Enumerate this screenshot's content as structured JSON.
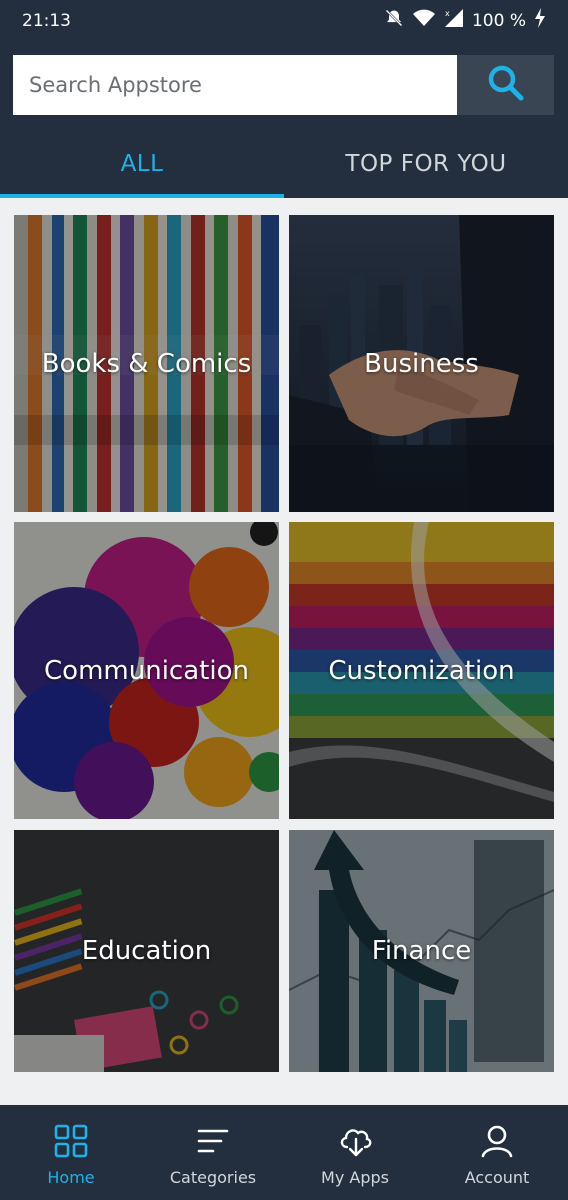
{
  "status_bar": {
    "time": "21:13",
    "battery": "100 %"
  },
  "search": {
    "placeholder": "Search Appstore"
  },
  "tabs": [
    {
      "label": "ALL",
      "active": true
    },
    {
      "label": "TOP FOR YOU",
      "active": false
    }
  ],
  "categories": [
    {
      "label": "Books & Comics"
    },
    {
      "label": "Business"
    },
    {
      "label": "Communication"
    },
    {
      "label": "Customization"
    },
    {
      "label": "Education"
    },
    {
      "label": "Finance"
    }
  ],
  "bottom_nav": [
    {
      "label": "Home",
      "icon": "grid-icon",
      "active": true
    },
    {
      "label": "Categories",
      "icon": "list-icon",
      "active": false
    },
    {
      "label": "My Apps",
      "icon": "cloud-download-icon",
      "active": false
    },
    {
      "label": "Account",
      "icon": "person-icon",
      "active": false
    }
  ],
  "colors": {
    "header_bg": "#232f3e",
    "accent": "#1fb2e6",
    "page_bg": "#eef0f1"
  }
}
